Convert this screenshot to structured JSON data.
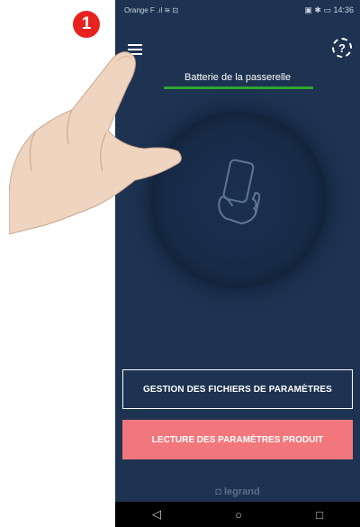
{
  "step": {
    "number": "1"
  },
  "status_bar": {
    "carrier": "Orange F",
    "time": "14:36"
  },
  "header": {
    "help_glyph": "?"
  },
  "battery": {
    "label": "Batterie de la passerelle",
    "color": "#2fa52f"
  },
  "buttons": {
    "files": "GESTION DES FICHIERS DE PARAMÈTRES",
    "read": "LECTURE DES PARAMÈTRES PRODUIT"
  },
  "brand": {
    "name": "legrand"
  },
  "navbar": {
    "back": "◁",
    "home": "○",
    "recents": "□"
  },
  "colors": {
    "background": "#1d3351",
    "accent_button": "#f2777c",
    "step_badge": "#e8231f"
  },
  "icons": [
    "menu-icon",
    "help-icon",
    "phone-hand-icon",
    "back-icon",
    "home-icon",
    "recents-icon"
  ]
}
